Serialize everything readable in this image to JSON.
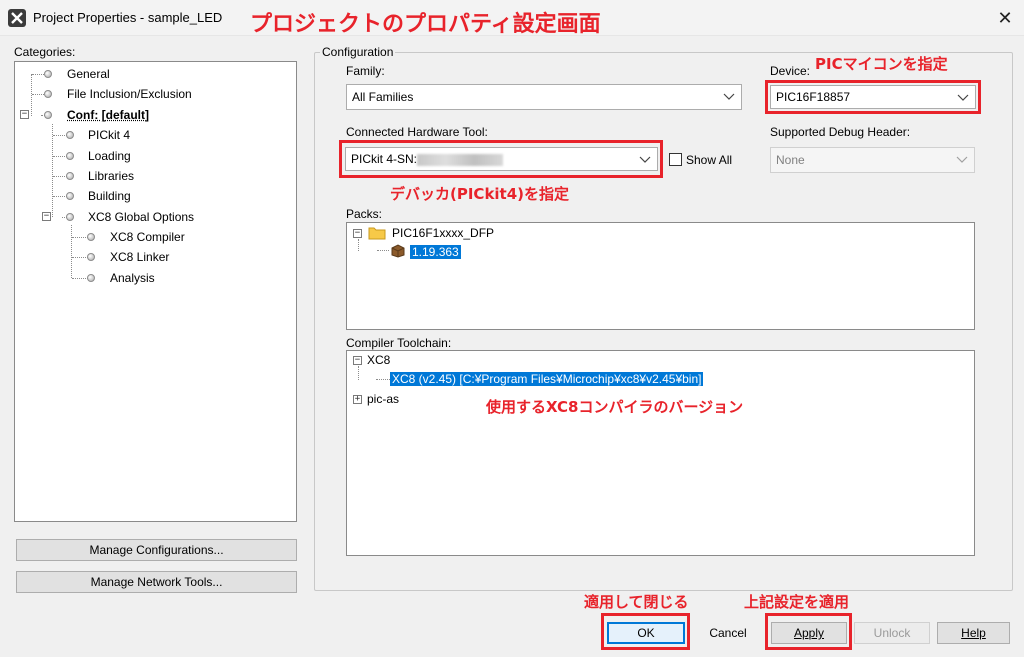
{
  "window": {
    "title": "Project Properties - sample_LED",
    "annotation_title": "プロジェクトのプロパティ設定画面"
  },
  "categories": {
    "label": "Categories:",
    "items": [
      {
        "label": "General"
      },
      {
        "label": "File Inclusion/Exclusion"
      },
      {
        "label": "Conf: [default]"
      },
      {
        "label": "PICkit 4"
      },
      {
        "label": "Loading"
      },
      {
        "label": "Libraries"
      },
      {
        "label": "Building"
      },
      {
        "label": "XC8 Global Options"
      },
      {
        "label": "XC8 Compiler"
      },
      {
        "label": "XC8 Linker"
      },
      {
        "label": "Analysis"
      }
    ],
    "manage_configurations": "Manage Configurations...",
    "manage_network_tools": "Manage Network Tools..."
  },
  "configuration": {
    "group_label": "Configuration",
    "family_label": "Family:",
    "family_value": "All Families",
    "device_label": "Device:",
    "device_value": "PIC16F18857",
    "device_annotation": "PICマイコンを指定",
    "hw_tool_label": "Connected Hardware Tool:",
    "hw_tool_value": "PICkit 4-SN:",
    "hw_tool_annotation": "デバッカ(PICkit4)を指定",
    "show_all_label": "Show All",
    "show_all_checked": false,
    "debug_header_label": "Supported Debug Header:",
    "debug_header_value": "None",
    "packs_label": "Packs:",
    "packs_root": "PIC16F1xxxx_DFP",
    "packs_version": "1.19.363",
    "toolchain_label": "Compiler Toolchain:",
    "toolchain_root": "XC8",
    "toolchain_selected": "XC8 (v2.45) [C:¥Program Files¥Microchip¥xc8¥v2.45¥bin]",
    "toolchain_other": "pic-as",
    "toolchain_annotation": "使用するXC8コンパイラのバージョン"
  },
  "buttons": {
    "ok": "OK",
    "ok_annotation": "適用して閉じる",
    "cancel": "Cancel",
    "apply": "Apply",
    "apply_annotation": "上記設定を適用",
    "unlock": "Unlock",
    "help": "Help"
  },
  "colors": {
    "annotation_red": "#e8232b",
    "selection_blue": "#0078d7"
  }
}
